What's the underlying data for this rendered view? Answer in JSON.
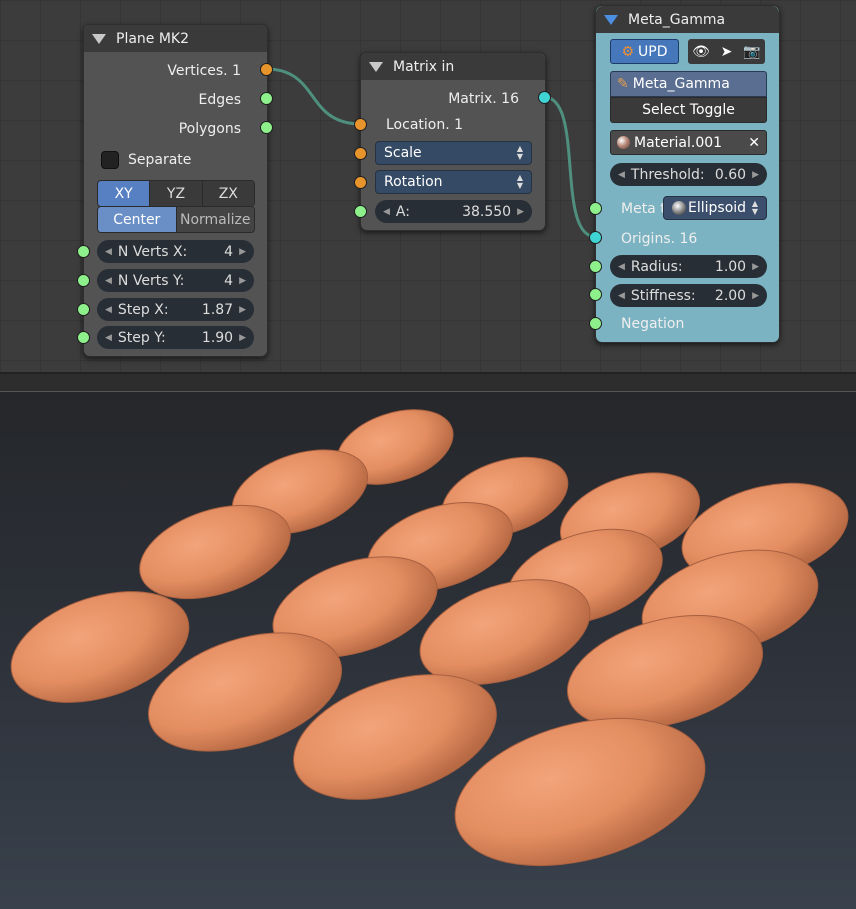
{
  "plane_node": {
    "title": "Plane MK2",
    "outputs": [
      "Vertices. 1",
      "Edges",
      "Polygons"
    ],
    "separate_label": "Separate",
    "axes": [
      "XY",
      "YZ",
      "ZX"
    ],
    "modes": [
      "Center",
      "Normalize"
    ],
    "fields": [
      {
        "label": "N Verts X:",
        "value": "4"
      },
      {
        "label": "N Verts Y:",
        "value": "4"
      },
      {
        "label": "Step X:",
        "value": "1.87"
      },
      {
        "label": "Step Y:",
        "value": "1.90"
      }
    ]
  },
  "matrix_node": {
    "title": "Matrix in",
    "output": "Matrix. 16",
    "location": "Location. 1",
    "scale": "Scale",
    "rotation": "Rotation",
    "angle_label": "A:",
    "angle_value": "38.550"
  },
  "meta_node": {
    "title": "Meta_Gamma",
    "upd": "UPD",
    "object_name": "Meta_Gamma",
    "select_toggle": "Select Toggle",
    "material": "Material.001",
    "threshold_label": "Threshold:",
    "threshold_value": "0.60",
    "meta_type_label": "Meta t",
    "meta_type_value": "Ellipsoid",
    "origins": "Origins. 16",
    "radius_label": "Radius:",
    "radius_value": "1.00",
    "stiffness_label": "Stiffness:",
    "stiffness_value": "2.00",
    "negation": "Negation"
  },
  "colors": {
    "node_bg": "#535353",
    "meta_bg": "#7bb3c2",
    "socket_orange": "#e8942c",
    "socket_green": "#8ef08a",
    "socket_cyan": "#3fd3d4",
    "link": "#4e8f7d",
    "metaball": "#e48e62"
  }
}
